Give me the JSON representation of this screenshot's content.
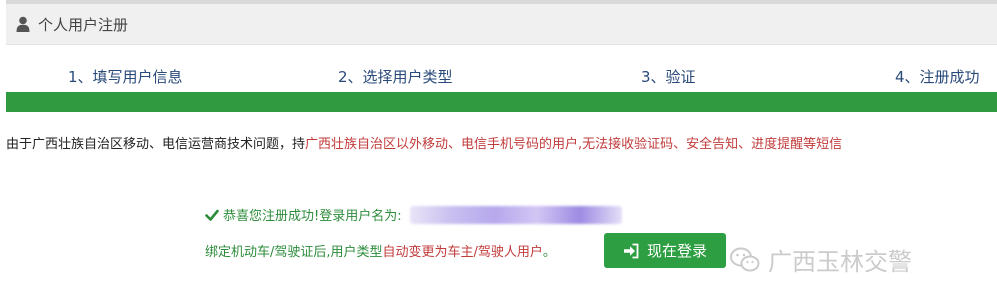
{
  "header": {
    "title": "个人用户注册",
    "icon": "user-icon"
  },
  "steps": [
    {
      "label": "1、填写用户信息"
    },
    {
      "label": "2、选择用户类型"
    },
    {
      "label": "3、验证"
    },
    {
      "label": "4、注册成功"
    }
  ],
  "progress": {
    "fraction": 1.0,
    "color": "#2f9a40"
  },
  "notice": {
    "part1": "由于广西壮族自治区移动、电信运营商技术问题，持",
    "part2": "广西壮族自治区以外移动、电信手机号码的用户,",
    "part3": "无法接收验证码、安全告知、进度提醒等短信"
  },
  "success": {
    "message": "恭喜您注册成功!登录用户名为:"
  },
  "bind_note": {
    "part1": "绑定机动车/驾驶证后,用户类型",
    "part2": "自动变更为车主/驾驶人用户",
    "part3": "。"
  },
  "login_button": {
    "label": "现在登录"
  },
  "watermark": {
    "text": "广西玉林交警",
    "icon": "wechat-icon"
  },
  "colors": {
    "accent_green": "#2e9e42",
    "warning_red": "#c23b3b",
    "step_blue": "#2a4a7a"
  }
}
